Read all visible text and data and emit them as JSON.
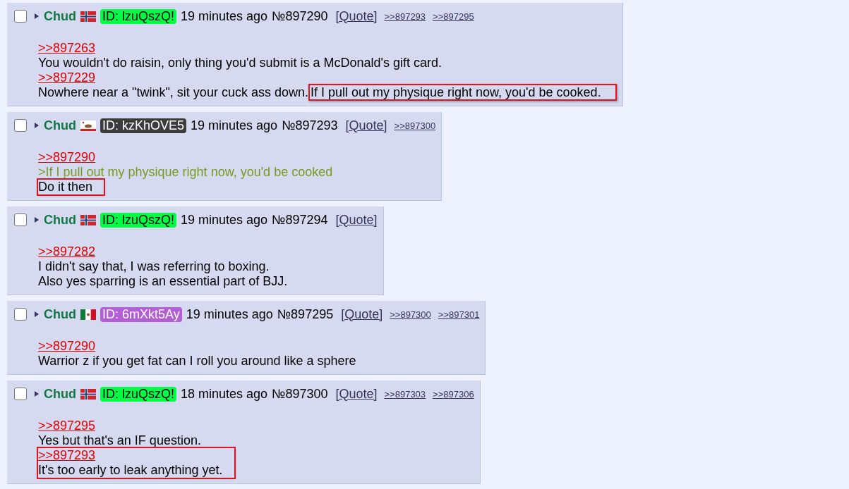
{
  "posts": [
    {
      "name": "Chud",
      "flag": {
        "kind": "norway"
      },
      "id": {
        "text": "ID: lzuQszQ!",
        "color": "#00ff44"
      },
      "time": "19 minutes ago",
      "number": "№897290",
      "quote": "[Quote]",
      "backlinks": [
        ">>897293",
        ">>897295"
      ],
      "checked": false,
      "blocks": [
        {
          "highlighted": false,
          "lines": [
            {
              "kind": "quotelink",
              "text": ">>897263"
            },
            {
              "kind": "text",
              "text": "You wouldn't do raisin, only thing you'd submit is a McDonald's gift card."
            },
            {
              "kind": "quotelink",
              "text": ">>897229"
            },
            {
              "kind": "text",
              "text": "Nowhere near a \"twink\", sit your cuck ass down.",
              "highlighted_text": "If I pull out my physique right now, you'd be cooked."
            }
          ]
        }
      ]
    },
    {
      "name": "Chud",
      "flag": {
        "kind": "california"
      },
      "id": {
        "text": "ID: kzKhOVE5",
        "color": "#3c3c3c"
      },
      "time": "19 minutes ago",
      "number": "№897293",
      "quote": "[Quote]",
      "backlinks": [
        ">>897300"
      ],
      "checked": false,
      "blocks": [
        {
          "highlighted": false,
          "lines": [
            {
              "kind": "quotelink",
              "text": ">>897290"
            },
            {
              "kind": "greentext",
              "text": ">If I pull out my physique right now, you'd be cooked"
            }
          ]
        },
        {
          "highlighted": true,
          "lines": [
            {
              "kind": "text",
              "text": "Do it then"
            }
          ]
        }
      ]
    },
    {
      "name": "Chud",
      "flag": {
        "kind": "norway"
      },
      "id": {
        "text": "ID: lzuQszQ!",
        "color": "#00ff44"
      },
      "time": "19 minutes ago",
      "number": "№897294",
      "quote": "[Quote]",
      "checked": false,
      "blocks": [
        {
          "highlighted": false,
          "lines": [
            {
              "kind": "quotelink",
              "text": ">>897282"
            },
            {
              "kind": "text",
              "text": "I didn't say that, I was referring to boxing."
            },
            {
              "kind": "text",
              "text": "Also yes sparring is an essential part of BJJ."
            }
          ]
        }
      ]
    },
    {
      "name": "Chud",
      "flag": {
        "kind": "mexico"
      },
      "id": {
        "text": "ID: 6mXkt5Ay",
        "color": "#b45ed6"
      },
      "time": "19 minutes ago",
      "number": "№897295",
      "quote": "[Quote]",
      "backlinks": [
        ">>897300",
        ">>897301"
      ],
      "checked": false,
      "blocks": [
        {
          "highlighted": false,
          "lines": [
            {
              "kind": "quotelink",
              "text": ">>897290"
            },
            {
              "kind": "text",
              "text": "Warrior z if you get fat can I roll you around like a sphere"
            }
          ]
        }
      ]
    },
    {
      "name": "Chud",
      "flag": {
        "kind": "norway"
      },
      "id": {
        "text": "ID: lzuQszQ!",
        "color": "#00ff44"
      },
      "time": "18 minutes ago",
      "number": "№897300",
      "quote": "[Quote]",
      "backlinks": [
        ">>897303",
        ">>897306"
      ],
      "checked": false,
      "blocks": [
        {
          "highlighted": false,
          "lines": [
            {
              "kind": "quotelink",
              "text": ">>897295"
            },
            {
              "kind": "text",
              "text": "Yes but that's an IF question."
            }
          ]
        },
        {
          "highlighted": true,
          "lines": [
            {
              "kind": "quotelink",
              "text": ">>897293"
            },
            {
              "kind": "text",
              "text": "It's too early to leak anything yet."
            }
          ]
        }
      ]
    }
  ]
}
